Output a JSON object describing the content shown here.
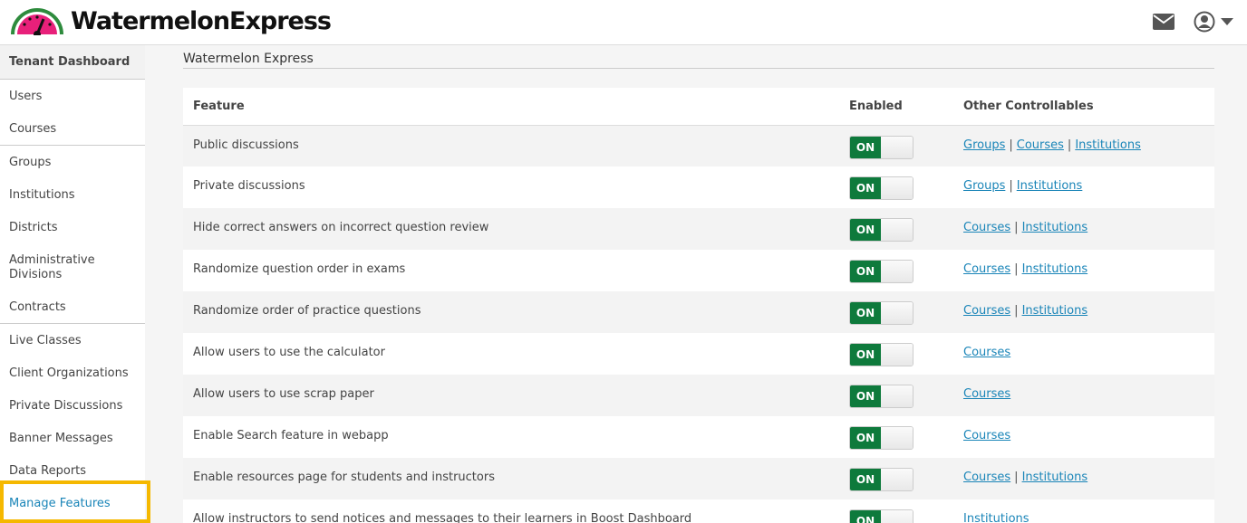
{
  "brand": {
    "name": "WatermelonExpress"
  },
  "header": {
    "icons": [
      "mail-icon",
      "user-icon",
      "caret-down-icon"
    ]
  },
  "sidebar": {
    "heading": "Tenant Dashboard",
    "groups": [
      [
        "Users",
        "Courses"
      ],
      [
        "Groups",
        "Institutions",
        "Districts",
        "Administrative Divisions",
        "Contracts"
      ],
      [
        "Live Classes",
        "Client Organizations",
        "Private Discussions",
        "Banner Messages",
        "Data Reports",
        "Manage Features"
      ]
    ],
    "selected": "Manage Features"
  },
  "main": {
    "title": "Watermelon Express",
    "columns": [
      "Feature",
      "Enabled",
      "Other Controllables"
    ],
    "toggle_label": "ON",
    "rows": [
      {
        "feature": "Public discussions",
        "links": [
          "Groups",
          "Courses",
          "Institutions"
        ]
      },
      {
        "feature": "Private discussions",
        "links": [
          "Groups",
          "Institutions"
        ]
      },
      {
        "feature": "Hide correct answers on incorrect question review",
        "links": [
          "Courses",
          "Institutions"
        ]
      },
      {
        "feature": "Randomize question order in exams",
        "links": [
          "Courses",
          "Institutions"
        ]
      },
      {
        "feature": "Randomize order of practice questions",
        "links": [
          "Courses",
          "Institutions"
        ]
      },
      {
        "feature": "Allow users to use the calculator",
        "links": [
          "Courses"
        ]
      },
      {
        "feature": "Allow users to use scrap paper",
        "links": [
          "Courses"
        ]
      },
      {
        "feature": "Enable Search feature in webapp",
        "links": [
          "Courses"
        ]
      },
      {
        "feature": "Enable resources page for students and instructors",
        "links": [
          "Courses",
          "Institutions"
        ]
      },
      {
        "feature": "Allow instructors to send notices and messages to their learners in Boost Dashboard",
        "links": [
          "Institutions"
        ]
      }
    ]
  },
  "colors": {
    "accent": "#1a85b8",
    "toggle_on": "#0e7a3c",
    "highlight": "#f5b800",
    "logo_rind": "#2e8b3d",
    "logo_flesh": "#e8207a"
  }
}
